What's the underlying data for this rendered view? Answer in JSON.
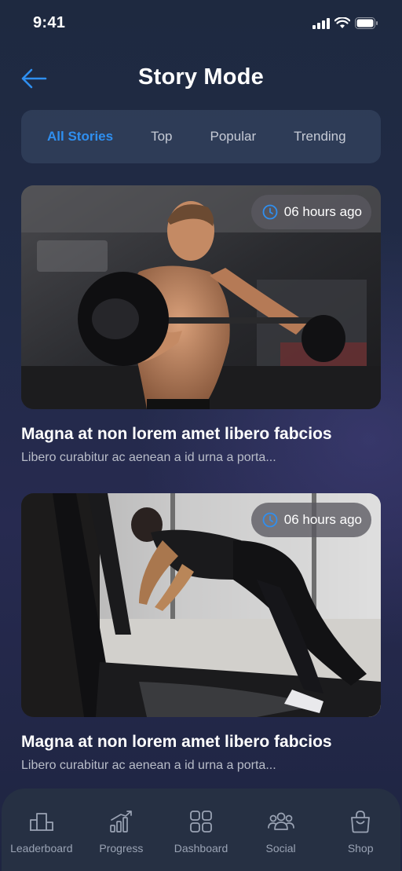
{
  "status_bar": {
    "time": "9:41"
  },
  "header": {
    "title": "Story Mode"
  },
  "tabs": [
    {
      "label": "All Stories",
      "active": true
    },
    {
      "label": "Top",
      "active": false
    },
    {
      "label": "Popular",
      "active": false
    },
    {
      "label": "Trending",
      "active": false
    }
  ],
  "stories": [
    {
      "time_ago": "06 hours ago",
      "title": "Magna at non lorem amet libero fabcios",
      "excerpt": "Libero curabitur ac aenean a id urna a porta..."
    },
    {
      "time_ago": "06 hours ago",
      "title": "Magna at non lorem amet libero fabcios",
      "excerpt": "Libero curabitur ac aenean a id urna a porta..."
    }
  ],
  "bottom_nav": [
    {
      "label": "Leaderboard",
      "icon": "leaderboard-icon"
    },
    {
      "label": "Progress",
      "icon": "progress-chart-icon"
    },
    {
      "label": "Dashboard",
      "icon": "dashboard-grid-icon"
    },
    {
      "label": "Social",
      "icon": "social-group-icon"
    },
    {
      "label": "Shop",
      "icon": "shopping-bag-icon"
    }
  ],
  "colors": {
    "accent": "#2f8ff0",
    "background": "#212b47",
    "nav_background": "#263043"
  }
}
